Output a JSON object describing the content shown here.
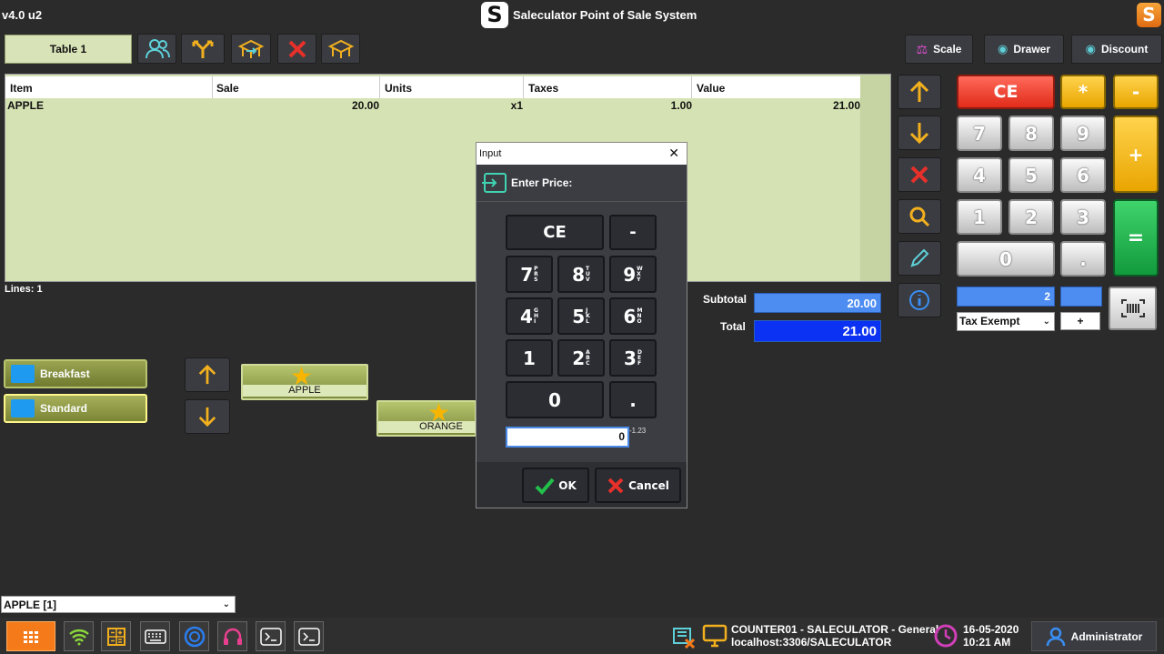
{
  "app": {
    "version": "v4.0 u2",
    "logo_letter": "S",
    "title": "Saleculator Point of Sale System"
  },
  "toolbar": {
    "table_label": "Table 1",
    "scale_label": "Scale",
    "drawer_label": "Drawer",
    "discount_label": "Discount"
  },
  "ticket": {
    "columns": [
      "Item",
      "Sale",
      "Units",
      "Taxes",
      "Value"
    ],
    "rows": [
      {
        "item": "APPLE",
        "sale": "20.00",
        "units": "x1",
        "taxes": "1.00",
        "value": "21.00"
      }
    ],
    "lines_label": "Lines: 1"
  },
  "totals": {
    "subtotal_label": "Subtotal",
    "subtotal_value": "20.00",
    "total_label": "Total",
    "total_value": "21.00"
  },
  "keypad": {
    "ce": "CE",
    "star": "*",
    "minus": "-",
    "plus": "+",
    "equals": "=",
    "keys": [
      "7",
      "8",
      "9",
      "4",
      "5",
      "6",
      "1",
      "2",
      "3",
      "0",
      "."
    ],
    "qty_value": "2",
    "tax_select": "Tax Exempt",
    "small_plus": "+"
  },
  "categories": [
    "Breakfast",
    "Standard"
  ],
  "products": [
    "APPLE",
    "ORANGE"
  ],
  "product_select": "APPLE [1]",
  "dialog": {
    "title": "Input",
    "close": "✕",
    "prompt": "Enter Price:",
    "ce": "CE",
    "minus": "-",
    "keys": [
      {
        "digit": "7",
        "letters": "PRS"
      },
      {
        "digit": "8",
        "letters": "TUV"
      },
      {
        "digit": "9",
        "letters": "WXY"
      },
      {
        "digit": "4",
        "letters": "GHI"
      },
      {
        "digit": "5",
        "letters": "JKL"
      },
      {
        "digit": "6",
        "letters": "MNO"
      },
      {
        "digit": "1",
        "letters": ""
      },
      {
        "digit": "2",
        "letters": "ABC"
      },
      {
        "digit": "3",
        "letters": "DEF"
      }
    ],
    "zero": "0",
    "dot": ".",
    "input_value": "0",
    "hint": "-1.23",
    "ok": "OK",
    "cancel": "Cancel"
  },
  "status": {
    "counter": "COUNTER01 - SALECULATOR - General",
    "host": "localhost:3306/SALECULATOR",
    "date": "16-05-2020",
    "time": "10:21 AM",
    "user": "Administrator"
  },
  "colors": {
    "accent_yellow": "#f2b01e",
    "accent_red": "#e8302a",
    "accent_green": "#17a846",
    "total_blue": "#0b31f2",
    "subtotal_blue": "#4d8cf1",
    "grid_green": "#d5e2b3"
  }
}
